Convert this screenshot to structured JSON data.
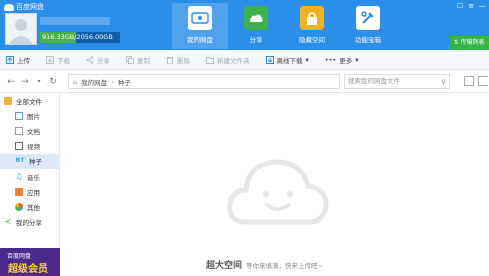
{
  "header": {
    "app_title": "百度网盘",
    "quota": "916.33GB/2056.00GB",
    "quota_fraction": 0.446,
    "nav": [
      {
        "label": "我的网盘",
        "active": true
      },
      {
        "label": "分享"
      },
      {
        "label": "隐藏空间"
      },
      {
        "label": "功能宝箱"
      }
    ],
    "transfer_label": "传输列表"
  },
  "toolbar": {
    "items": [
      {
        "label": "上传",
        "enabled": true
      },
      {
        "label": "下载",
        "enabled": false
      },
      {
        "label": "分享",
        "enabled": false
      },
      {
        "label": "复制",
        "enabled": false
      },
      {
        "label": "删除",
        "enabled": false
      },
      {
        "label": "新建文件夹",
        "enabled": false
      },
      {
        "label": "离线下载",
        "enabled": true
      },
      {
        "label": "更多",
        "enabled": true
      }
    ]
  },
  "address": {
    "root": "我的网盘",
    "current": "种子",
    "search_placeholder": "搜索我的网盘文件"
  },
  "sidebar": {
    "items": [
      {
        "label": "全部文件",
        "icon": "folder-icon",
        "top": true
      },
      {
        "label": "图片",
        "icon": "image-icon"
      },
      {
        "label": "文档",
        "icon": "document-icon"
      },
      {
        "label": "视频",
        "icon": "video-icon"
      },
      {
        "label": "种子",
        "icon": "bt-icon",
        "active": true
      },
      {
        "label": "音乐",
        "icon": "music-icon"
      },
      {
        "label": "应用",
        "icon": "app-icon"
      },
      {
        "label": "其他",
        "icon": "other-icon"
      },
      {
        "label": "我的分享",
        "icon": "share-icon",
        "top": true
      }
    ],
    "promo_line1": "百度网盘",
    "promo_line2": "超级会员"
  },
  "empty": {
    "title": "超大空间",
    "subtitle": "等你来填满，快来上传吧~"
  },
  "colors": {
    "header": "#2b8ee8",
    "quota_used": "#49b04a",
    "transfer": "#34b44a",
    "sidebar_active": "#dce9f8"
  }
}
